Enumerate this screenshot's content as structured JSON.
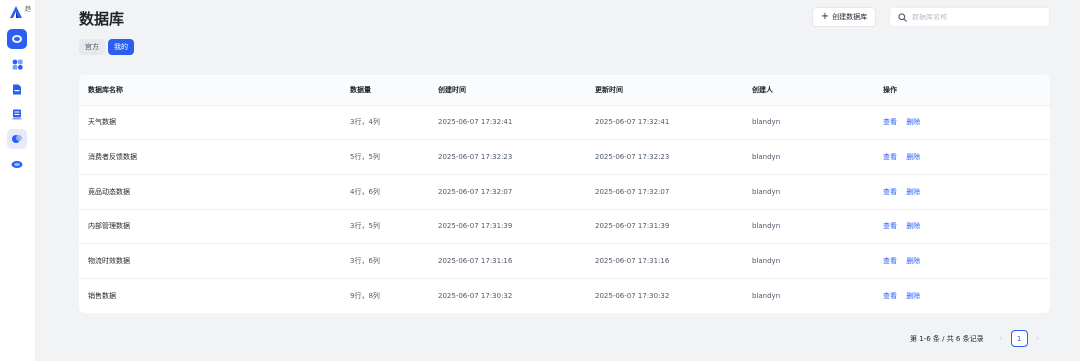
{
  "sidebar": {
    "logo_text": "趋",
    "items": [
      {
        "name": "sidebar-item-database",
        "icon": "database-icon",
        "active": true
      },
      {
        "name": "sidebar-item-apps",
        "icon": "apps-icon",
        "active": false
      },
      {
        "name": "sidebar-item-docs",
        "icon": "document-icon",
        "active": false
      },
      {
        "name": "sidebar-item-storage",
        "icon": "storage-icon",
        "active": false
      },
      {
        "name": "sidebar-item-analytics",
        "icon": "analytics-icon",
        "active": false
      },
      {
        "name": "sidebar-item-chat",
        "icon": "chat-icon",
        "active": false
      }
    ]
  },
  "header": {
    "title": "数据库",
    "create_label": "创建数据库",
    "search_placeholder": "数据库名称"
  },
  "tabs": {
    "official": "官方",
    "mine": "我的"
  },
  "table": {
    "headers": {
      "name": "数据库名称",
      "count": "数据量",
      "created": "创建时间",
      "updated": "更新时间",
      "creator": "创建人",
      "actions": "操作"
    },
    "action_view": "查看",
    "action_delete": "删除",
    "rows": [
      {
        "name": "天气数据",
        "count": "3行，4列",
        "created": "2025-06-07 17:32:41",
        "updated": "2025-06-07 17:32:41",
        "creator": "blandyn"
      },
      {
        "name": "消费者反馈数据",
        "count": "5行，5列",
        "created": "2025-06-07 17:32:23",
        "updated": "2025-06-07 17:32:23",
        "creator": "blandyn"
      },
      {
        "name": "竞品动态数据",
        "count": "4行，6列",
        "created": "2025-06-07 17:32:07",
        "updated": "2025-06-07 17:32:07",
        "creator": "blandyn"
      },
      {
        "name": "内部管理数据",
        "count": "3行，5列",
        "created": "2025-06-07 17:31:39",
        "updated": "2025-06-07 17:31:39",
        "creator": "blandyn"
      },
      {
        "name": "物流时效数据",
        "count": "3行，6列",
        "created": "2025-06-07 17:31:16",
        "updated": "2025-06-07 17:31:16",
        "creator": "blandyn"
      },
      {
        "name": "销售数据",
        "count": "9行，8列",
        "created": "2025-06-07 17:30:32",
        "updated": "2025-06-07 17:30:32",
        "creator": "blandyn"
      }
    ]
  },
  "pagination": {
    "info": "第 1-6 条 / 共 6 条记录",
    "current_page": "1",
    "prev": "‹",
    "next": "›"
  },
  "colors": {
    "accent": "#2b5ff2",
    "background": "#f2f3f5"
  }
}
